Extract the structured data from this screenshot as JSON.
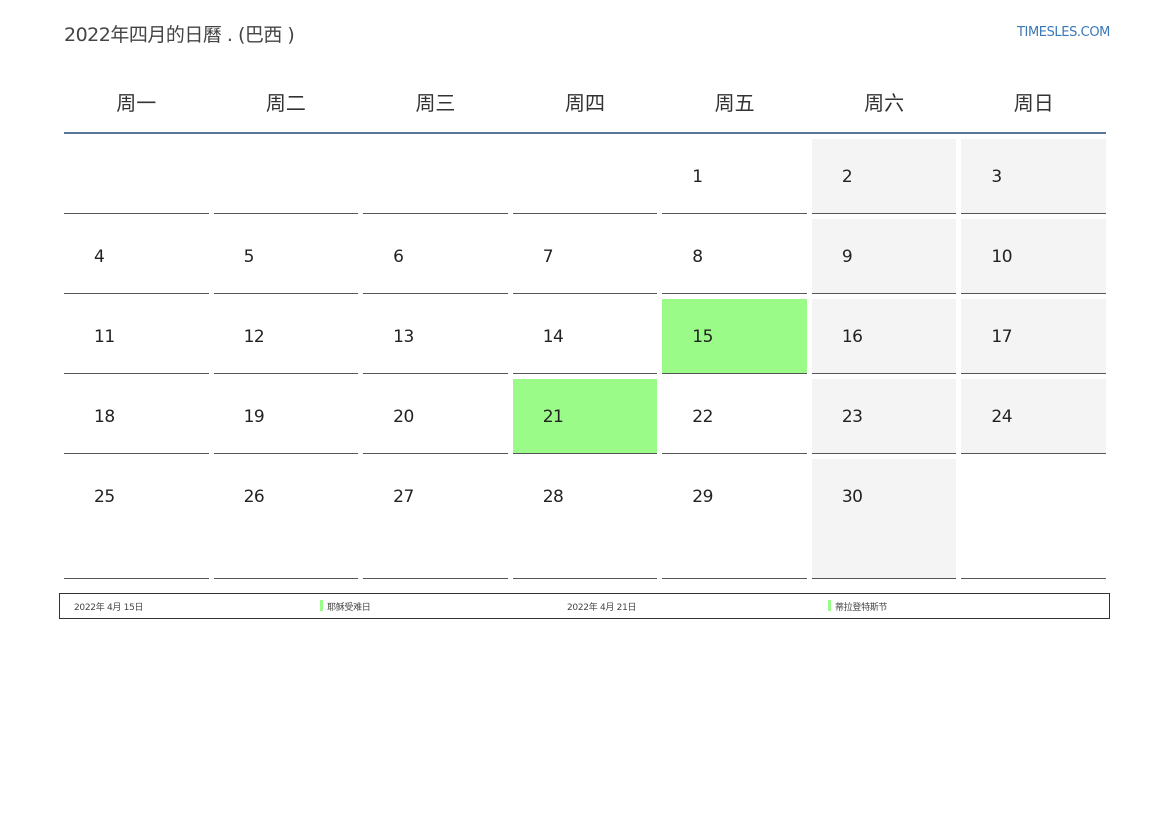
{
  "header": {
    "title": "2022年四月的日曆 . (巴西 )",
    "site": "TIMESLES.COM"
  },
  "calendar": {
    "weekdays": [
      "周一",
      "周二",
      "周三",
      "周四",
      "周五",
      "周六",
      "周日"
    ],
    "days": [
      "",
      "",
      "",
      "",
      "1",
      "2",
      "3",
      "4",
      "5",
      "6",
      "7",
      "8",
      "9",
      "10",
      "11",
      "12",
      "13",
      "14",
      "15",
      "16",
      "17",
      "18",
      "19",
      "20",
      "21",
      "22",
      "23",
      "24",
      "25",
      "26",
      "27",
      "28",
      "29",
      "30",
      ""
    ],
    "holiday_days": [
      "15",
      "21"
    ],
    "colors": {
      "holiday": "#9bfb88",
      "weekend": "#f4f4f4",
      "header_rule": "#5a7595",
      "link": "#3a78b8"
    }
  },
  "holidays": [
    {
      "date": "2022年 4月 15日",
      "name": "耶稣受难日"
    },
    {
      "date": "2022年 4月 21日",
      "name": "蒂拉登特斯节"
    }
  ]
}
